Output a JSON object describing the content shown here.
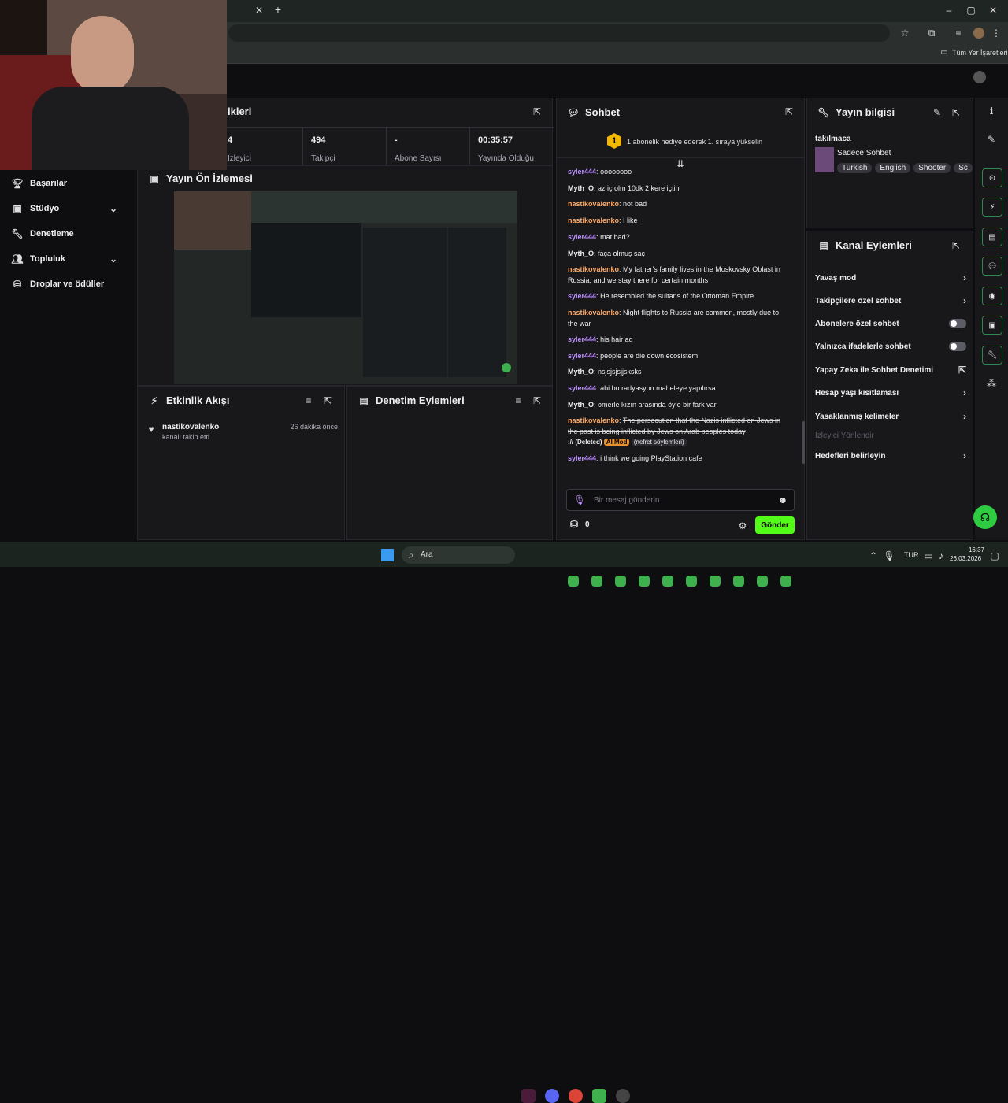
{
  "browser": {
    "bookmarks_label": "Tüm Yer İşaretleri",
    "close_tab": "✕",
    "new_tab": "+"
  },
  "stats_panel": {
    "title": "İzleyici İstatistikleri",
    "title_visible": "ikleri",
    "items": [
      {
        "value": "4",
        "label": "İzleyici"
      },
      {
        "value": "494",
        "label": "Takipçi"
      },
      {
        "value": "-",
        "label": "Abone Sayısı"
      },
      {
        "value": "00:35:57",
        "label": "Yayında Olduğu"
      }
    ]
  },
  "sidebar": {
    "items": [
      {
        "label": "Başarılar",
        "icon": "trophy-icon"
      },
      {
        "label": "Stüdyo",
        "icon": "studio-icon"
      },
      {
        "label": "Denetleme",
        "icon": "wrench-icon"
      },
      {
        "label": "Topluluk",
        "icon": "community-icon"
      },
      {
        "label": "Droplar ve ödüller",
        "icon": "drops-icon"
      }
    ]
  },
  "preview": {
    "title": "Yayın Ön İzlemesi"
  },
  "activity": {
    "title": "Etkinlik Akışı",
    "items": [
      {
        "user": "nastikovalenko",
        "action": "kanalı takip etti",
        "time": "26 dakika önce"
      }
    ]
  },
  "mod_actions": {
    "title": "Denetim Eylemleri"
  },
  "chat": {
    "title": "Sohbet",
    "hype": "1 abonelik hediye ederek 1. sıraya yükselin",
    "hype_num": "1",
    "messages": [
      {
        "user": "syler444",
        "color": "purple",
        "text": "oooooooo"
      },
      {
        "user": "Myth_O",
        "color": "white",
        "text": "az iç olm 10dk 2 kere içtin"
      },
      {
        "user": "nastikovalenko",
        "color": "orange",
        "text": "not bad"
      },
      {
        "user": "nastikovalenko",
        "color": "orange",
        "text": "I like"
      },
      {
        "user": "syler444",
        "color": "purple",
        "text": "mat bad?"
      },
      {
        "user": "Myth_O",
        "color": "white",
        "text": "façа olmuş saç"
      },
      {
        "user": "nastikovalenko",
        "color": "orange",
        "text": "My father's family lives in the Moskovsky Oblast in Russia, and we stay there for certain months"
      },
      {
        "user": "syler444",
        "color": "purple",
        "text": "He resembled the sultans of the Ottoman Empire."
      },
      {
        "user": "nastikovalenko",
        "color": "orange",
        "text": "Night flights to Russia are common, mostly due to the war"
      },
      {
        "user": "syler444",
        "color": "purple",
        "text": "his hair aq"
      },
      {
        "user": "syler444",
        "color": "purple",
        "text": "people are die down ecosistem"
      },
      {
        "user": "Myth_O",
        "color": "white",
        "text": "nsjsjsjsjjsksks"
      },
      {
        "user": "syler444",
        "color": "purple",
        "text": "abi bu radyasyon maheleye yapılırsa"
      },
      {
        "user": "Myth_O",
        "color": "white",
        "text": "omerle kızın arasında öyle bir fark var"
      }
    ],
    "deleted": {
      "user": "nastikovalenko",
      "text": "The persecution that the Nazis inflicted on Jews in the past is being inflicted by Jews on Arab peoples today",
      "tag": ":// (Deleted)",
      "ai": "AI Mod",
      "reason": "(nefret söylemleri)"
    },
    "last": {
      "user": "syler444",
      "text": "i think we going PlayStation cafe"
    },
    "placeholder": "Bir mesaj gönderin",
    "points": "0",
    "send": "Gönder"
  },
  "stream_info": {
    "title": "Yayın bilgisi",
    "stream_title": "takılmaca",
    "category": "Sadece Sohbet",
    "tags": [
      "Turkish",
      "English",
      "Shooter",
      "Sc"
    ]
  },
  "channel_actions": {
    "title": "Kanal Eylemleri",
    "items": [
      {
        "label": "Yavaş mod",
        "control": "chevron"
      },
      {
        "label": "Takipçilere özel sohbet",
        "control": "chevron"
      },
      {
        "label": "Abonelere özel sohbet",
        "control": "toggle"
      },
      {
        "label": "Yalnızca ifadelerle sohbet",
        "control": "toggle"
      },
      {
        "label": "Yapay Zeka ile Sohbet Denetimi",
        "control": "external"
      },
      {
        "label": "Hesap yaşı kısıtlaması",
        "control": "chevron"
      },
      {
        "label": "Yasaklanmış kelimeler",
        "control": "chevron"
      },
      {
        "label": "İzleyici Yönlendir",
        "control": "none",
        "disabled": true
      },
      {
        "label": "Hedefleri belirleyin",
        "control": "chevron"
      }
    ]
  },
  "taskbar": {
    "search": "Ara",
    "lang": "TUR",
    "time": "16:37",
    "date": "26.03.2026"
  },
  "colors": {
    "accent": "#53fc18",
    "purple": "#bf94ff",
    "orange": "#ffaa66"
  }
}
